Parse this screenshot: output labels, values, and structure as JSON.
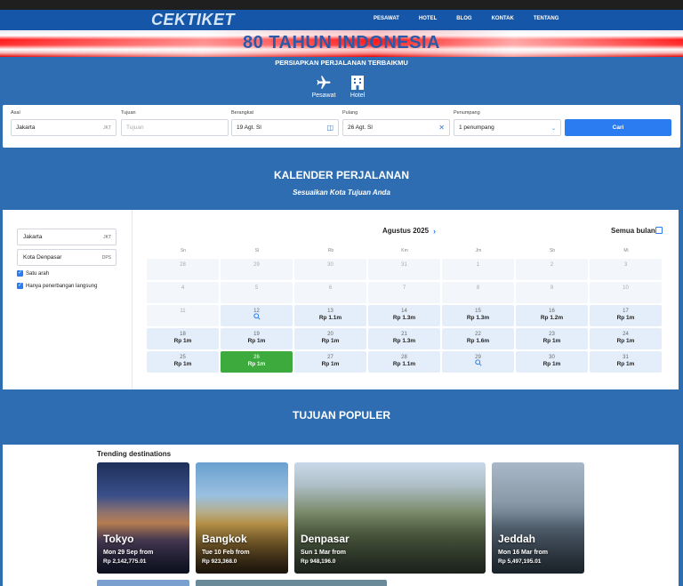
{
  "nav": {
    "logo": "CEKTIKET",
    "links": [
      "PESAWAT",
      "HOTEL",
      "BLOG",
      "KONTAK",
      "TENTANG"
    ]
  },
  "banner": {
    "title": "80 TAHUN INDONESIA"
  },
  "hero": {
    "subtitle": "PERSIAPKAN PERJALANAN TERBAIKMU",
    "modes": [
      {
        "label": "Pesawat",
        "icon": "airplane-icon"
      },
      {
        "label": "Hotel",
        "icon": "hotel-icon"
      }
    ]
  },
  "search": {
    "asal": {
      "label": "Asal",
      "value": "Jakarta",
      "code": "JKT"
    },
    "tujuan": {
      "label": "Tujuan",
      "placeholder": "Tujuan"
    },
    "berangkat": {
      "label": "Berangkat",
      "value": "19 Agt. Sl"
    },
    "pulang": {
      "label": "Pulang",
      "value": "26 Agt. Sl"
    },
    "penumpang": {
      "label": "Penumpang",
      "value": "1 penumpang"
    },
    "submit": "Cari"
  },
  "calendar_section": {
    "title": "KALENDER PERJALANAN",
    "subtitle": "Sesuaikan Kota Tujuan Anda",
    "from": {
      "value": "Jakarta",
      "code": "JKT"
    },
    "to": {
      "value": "Kota Denpasar",
      "code": "DPS"
    },
    "options": [
      "Satu arah",
      "Hanya penerbangan langsung"
    ],
    "month": "Agustus 2025",
    "all_months": "Semua bulan",
    "weekdays": [
      "Sn",
      "Sl",
      "Rb",
      "Km",
      "Jm",
      "Sb",
      "Mi"
    ],
    "rows": [
      [
        {
          "d": "28"
        },
        {
          "d": "29"
        },
        {
          "d": "30"
        },
        {
          "d": "31"
        },
        {
          "d": "1"
        },
        {
          "d": "2"
        },
        {
          "d": "3"
        }
      ],
      [
        {
          "d": "4"
        },
        {
          "d": "5"
        },
        {
          "d": "6"
        },
        {
          "d": "7"
        },
        {
          "d": "8"
        },
        {
          "d": "9"
        },
        {
          "d": "10"
        }
      ],
      [
        {
          "d": "11"
        },
        {
          "d": "12",
          "a": 1,
          "q": 1
        },
        {
          "d": "13",
          "a": 1,
          "p": "Rp 1.1m"
        },
        {
          "d": "14",
          "a": 1,
          "p": "Rp 1.3m"
        },
        {
          "d": "15",
          "a": 1,
          "p": "Rp 1.3m"
        },
        {
          "d": "16",
          "a": 1,
          "p": "Rp 1.2m"
        },
        {
          "d": "17",
          "a": 1,
          "p": "Rp 1m"
        }
      ],
      [
        {
          "d": "18",
          "a": 1,
          "p": "Rp 1m"
        },
        {
          "d": "19",
          "a": 1,
          "p": "Rp 1m"
        },
        {
          "d": "20",
          "a": 1,
          "p": "Rp 1m"
        },
        {
          "d": "21",
          "a": 1,
          "p": "Rp 1.3m"
        },
        {
          "d": "22",
          "a": 1,
          "p": "Rp 1.6m"
        },
        {
          "d": "23",
          "a": 1,
          "p": "Rp 1m"
        },
        {
          "d": "24",
          "a": 1,
          "p": "Rp 1m"
        }
      ],
      [
        {
          "d": "25",
          "a": 1,
          "p": "Rp 1m"
        },
        {
          "d": "26",
          "a": 1,
          "s": 1,
          "p": "Rp 1m"
        },
        {
          "d": "27",
          "a": 1,
          "p": "Rp 1m"
        },
        {
          "d": "28",
          "a": 1,
          "p": "Rp 1.1m"
        },
        {
          "d": "29",
          "a": 1,
          "q": 1
        },
        {
          "d": "30",
          "a": 1,
          "p": "Rp 1m"
        },
        {
          "d": "31",
          "a": 1,
          "p": "Rp 1m"
        }
      ]
    ]
  },
  "popular": {
    "title": "TUJUAN POPULER",
    "trending_label": "Trending destinations",
    "cards": [
      {
        "city": "Tokyo",
        "when": "Mon 29 Sep from",
        "price": "Rp 2,142,775.01"
      },
      {
        "city": "Bangkok",
        "when": "Tue 10 Feb from",
        "price": "Rp 923,368.0"
      },
      {
        "city": "Denpasar",
        "when": "Sun 1 Mar from",
        "price": "Rp 948,196.0"
      },
      {
        "city": "Jeddah",
        "when": "Mon 16 Mar from",
        "price": "Rp 5,497,195.01"
      }
    ]
  },
  "colors": {
    "page_bg": "#2f6db3",
    "nav_bg": "#1656a8",
    "accent": "#2a7cf0",
    "selected_day": "#3daa3d"
  }
}
